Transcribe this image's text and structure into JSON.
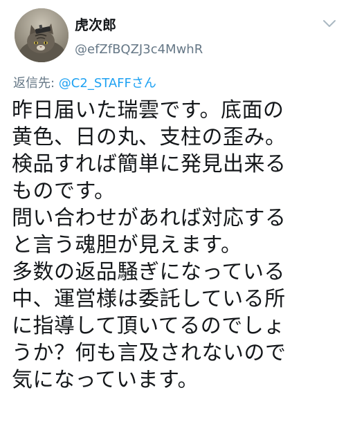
{
  "user": {
    "display_name": "虎次郎",
    "handle": "@efZfBQZJ3c4MwhR"
  },
  "icons": {
    "avatar": "cat-avatar",
    "menu": "chevron-down-icon"
  },
  "reply": {
    "prefix": "返信先: ",
    "mention": "@C2_STAFFさん"
  },
  "tweet": {
    "lines": [
      "昨日届いた瑞雲です。底面の",
      "黄色、日の丸、支柱の歪み。",
      "検品すれば簡単に発見出来る",
      "ものです。",
      "問い合わせがあれば対応する",
      "と言う魂胆が見えます。",
      "多数の返品騒ぎになっている",
      "中、運営様は委託している所",
      "に指導して頂いてるのでしょ",
      "うか？何も言及されないので",
      "気になっています。"
    ]
  },
  "colors": {
    "text": "#14171a",
    "secondary": "#657786",
    "link": "#1da1f2",
    "background": "#ffffff"
  }
}
